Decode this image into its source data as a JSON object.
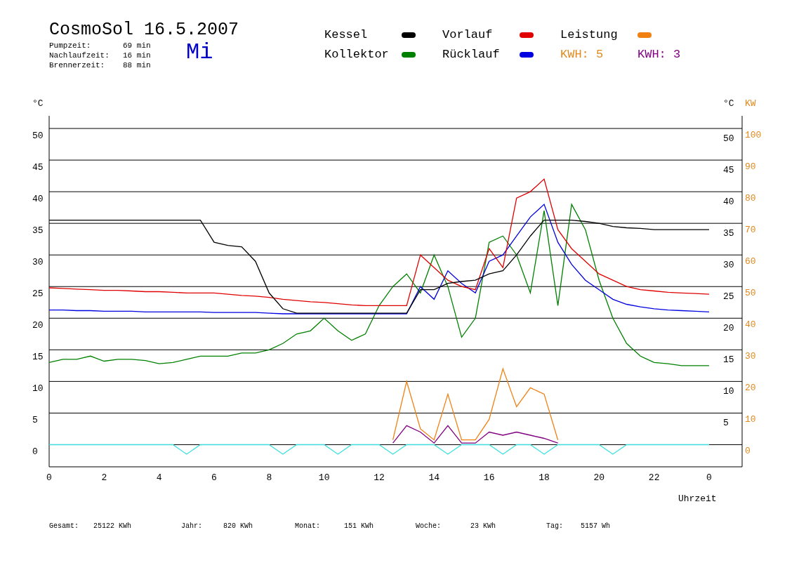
{
  "header": {
    "title": "CosmoSol 16.5.2007",
    "weekday": "Mi",
    "stats": [
      {
        "label": "Pumpzeit:",
        "value": "69 min"
      },
      {
        "label": "Nachlaufzeit:",
        "value": "16 min"
      },
      {
        "label": "Brennerzeit:",
        "value": "88 min"
      }
    ]
  },
  "legend": {
    "items": [
      {
        "label": "KWH: 5",
        "color": "#e08a20"
      }
    ]
  },
  "chart": {
    "x_end_label": "0",
    "right_axis": {
      "unit": "°C",
      "labels": [
        "50",
        "45",
        "40",
        "35",
        "30",
        "25",
        "20",
        "15",
        "10",
        "5"
      ]
    },
    "chart_data": {
      "type": "line",
      "xlabel": "Uhrzeit",
      "ylabel": "°C",
      "y2label": "KW",
      "grid": true,
      "xlim": [
        0,
        25.2
      ],
      "ylim": [
        -3.5,
        52
      ],
      "y2lim": [
        -7,
        104
      ],
      "xticks": [
        0,
        2,
        4,
        6,
        8,
        10,
        12,
        14,
        16,
        18,
        20,
        22
      ],
      "yticks": [
        0,
        5,
        10,
        15,
        20,
        25,
        30,
        35,
        40,
        45,
        50
      ],
      "y2ticks": [
        0,
        10,
        20,
        30,
        40,
        50,
        60,
        70,
        80,
        90,
        100
      ],
      "x": [
        0,
        0.5,
        1,
        1.5,
        2,
        2.5,
        3,
        3.5,
        4,
        4.5,
        5,
        5.5,
        6,
        6.5,
        7,
        7.5,
        8,
        8.5,
        9,
        9.5,
        10,
        10.5,
        11,
        11.5,
        12,
        12.5,
        13,
        13.5,
        14,
        14.5,
        15,
        15.5,
        16,
        16.5,
        17,
        17.5,
        18,
        18.5,
        19,
        19.5,
        20,
        20.5,
        21,
        21.5,
        22,
        22.5,
        23,
        23.5,
        24
      ],
      "series": [
        {
          "name": "Kessel",
          "color": "#000000",
          "values": [
            35.5,
            35.5,
            35.5,
            35.5,
            35.5,
            35.5,
            35.5,
            35.5,
            35.5,
            35.5,
            35.5,
            35.5,
            32,
            31.5,
            31.3,
            29,
            24,
            21.5,
            20.8,
            20.8,
            20.8,
            20.8,
            20.8,
            20.8,
            20.8,
            20.8,
            20.8,
            24.5,
            24.5,
            25.5,
            25.8,
            26,
            27,
            27.5,
            30,
            33,
            35.5,
            35.5,
            35.5,
            35.3,
            35,
            34.5,
            34.3,
            34.2,
            34,
            34,
            34,
            34,
            34
          ]
        },
        {
          "name": "Vorlauf",
          "color": "#e00000",
          "values": [
            24.8,
            24.7,
            24.6,
            24.5,
            24.4,
            24.4,
            24.3,
            24.2,
            24.2,
            24.1,
            24.0,
            24.0,
            24.0,
            23.8,
            23.6,
            23.5,
            23.3,
            23.0,
            22.8,
            22.6,
            22.5,
            22.3,
            22.1,
            22.0,
            22.0,
            22.0,
            22.0,
            30,
            28,
            26,
            25,
            24.5,
            31,
            28,
            39,
            40,
            42,
            34,
            31,
            29,
            27,
            26,
            25,
            24.5,
            24.3,
            24.1,
            24,
            23.9,
            23.8
          ]
        },
        {
          "name": "Leistung",
          "color": "#f08010",
          "axis": "y2",
          "values": [
            null,
            null,
            null,
            null,
            null,
            null,
            null,
            null,
            null,
            null,
            null,
            null,
            null,
            null,
            null,
            null,
            null,
            null,
            null,
            null,
            null,
            null,
            null,
            null,
            null,
            1.5,
            20,
            5,
            1.5,
            16,
            1.5,
            1.5,
            8,
            24,
            12,
            18,
            16,
            1.5,
            null,
            null,
            null,
            null,
            null,
            null,
            null,
            null,
            null,
            null,
            null
          ]
        },
        {
          "name": "Kollektor",
          "color": "#008000",
          "values": [
            13,
            13.5,
            13.5,
            14,
            13.2,
            13.5,
            13.5,
            13.3,
            12.8,
            13,
            13.5,
            14,
            14,
            14,
            14.5,
            14.5,
            15,
            16,
            17.5,
            18,
            20,
            18,
            16.5,
            17.5,
            22,
            25,
            27,
            24,
            30,
            25,
            17,
            20,
            32,
            33,
            30,
            24,
            37,
            22,
            38,
            34,
            26,
            20,
            16,
            14,
            13,
            12.8,
            12.5,
            12.5,
            12.5
          ]
        },
        {
          "name": "Rücklauf",
          "color": "#0000e0",
          "values": [
            21.3,
            21.3,
            21.2,
            21.2,
            21.1,
            21.1,
            21.1,
            21.0,
            21.0,
            21.0,
            21.0,
            21.0,
            20.9,
            20.9,
            20.9,
            20.9,
            20.8,
            20.7,
            20.7,
            20.7,
            20.7,
            20.7,
            20.7,
            20.7,
            20.7,
            20.7,
            20.7,
            25,
            23,
            27.5,
            25.5,
            24,
            29,
            30,
            33,
            36,
            38,
            32,
            28.5,
            26,
            24.5,
            23,
            22.2,
            21.8,
            21.5,
            21.3,
            21.2,
            21.1,
            21.0
          ]
        },
        {
          "name": "KWH: 3",
          "color": "#800080",
          "axis": "y2",
          "values": [
            null,
            null,
            null,
            null,
            null,
            null,
            null,
            null,
            null,
            null,
            null,
            null,
            null,
            null,
            null,
            null,
            null,
            null,
            null,
            null,
            null,
            null,
            null,
            null,
            null,
            0.5,
            6,
            4,
            0.5,
            6,
            0.5,
            0.5,
            4,
            3,
            4,
            3,
            2,
            0.5,
            null,
            null,
            null,
            null,
            null,
            null,
            null,
            null,
            null,
            null,
            null
          ]
        },
        {
          "color": "#40e0e0",
          "values": [
            0,
            0,
            0,
            0,
            0,
            0,
            0,
            0,
            0,
            0,
            -1.5,
            0,
            0,
            0,
            0,
            0,
            0,
            -1.5,
            0,
            0,
            0,
            -1.5,
            0,
            0,
            0,
            -1.5,
            0,
            0,
            0,
            -1.5,
            0,
            0,
            0,
            -1.5,
            0,
            0,
            -1.5,
            0,
            0,
            0,
            0,
            -1.5,
            0,
            0,
            0,
            0,
            0,
            0,
            0
          ]
        }
      ]
    }
  },
  "footer": {
    "totals": [
      {
        "label": "Gesamt:",
        "value": "25122 KWh"
      },
      {
        "label": "Jahr:",
        "value": "820 KWh"
      },
      {
        "label": "Monat:",
        "value": "151 KWh"
      },
      {
        "label": "Woche:",
        "value": "23 KWh"
      },
      {
        "label": "Tag:",
        "value": "5157 Wh"
      }
    ]
  }
}
